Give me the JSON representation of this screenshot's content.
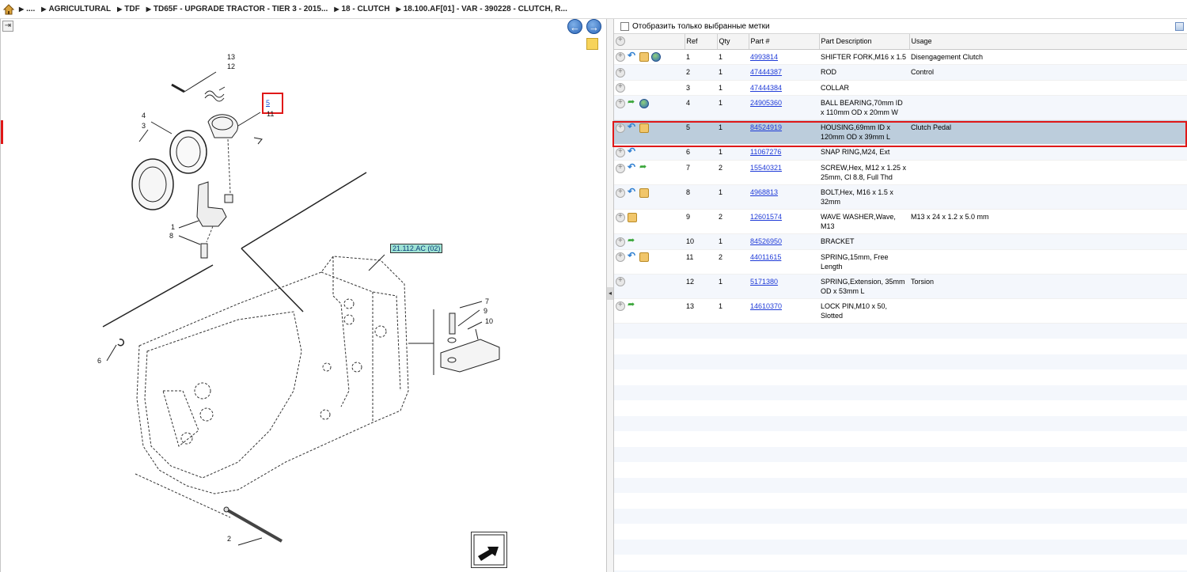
{
  "breadcrumb": {
    "items": [
      "....",
      "AGRICULTURAL",
      "TDF",
      "TD65F - UPGRADE TRACTOR - TIER 3 - 2015...",
      "18 - CLUTCH",
      "18.100.AF[01] - VAR - 390228 - CLUTCH, R..."
    ]
  },
  "diagram": {
    "ref_labels": [
      "13",
      "12",
      "5",
      "11",
      "4",
      "3",
      "1",
      "8",
      "7",
      "9",
      "10",
      "6",
      "2"
    ],
    "link_label": "21.112.AC (02)",
    "highlight_ref": "5"
  },
  "filter": {
    "label": "Отобразить только выбранные метки",
    "checked": false
  },
  "table": {
    "headers": [
      "Ref",
      "Qty",
      "Part #",
      "Part Description",
      "Usage"
    ],
    "rows": [
      {
        "icons": [
          "add-icon",
          "back-arrow-icon",
          "package-icon",
          "globe-icon"
        ],
        "ref": "1",
        "qty": "1",
        "part": "4993814",
        "desc": "SHIFTER FORK,M16 x 1.5",
        "usage": "Disengagement Clutch"
      },
      {
        "icons": [
          "add-icon"
        ],
        "ref": "2",
        "qty": "1",
        "part": "47444387",
        "desc": "ROD",
        "usage": "Control"
      },
      {
        "icons": [
          "add-icon"
        ],
        "ref": "3",
        "qty": "1",
        "part": "47444384",
        "desc": "COLLAR",
        "usage": ""
      },
      {
        "icons": [
          "add-icon",
          "forward-arrow-icon",
          "globe-icon"
        ],
        "ref": "4",
        "qty": "1",
        "part": "24905360",
        "desc": "BALL BEARING,70mm ID x 110mm OD x 20mm W",
        "usage": ""
      },
      {
        "icons": [
          "add-icon",
          "back-arrow-icon",
          "package-icon"
        ],
        "ref": "5",
        "qty": "1",
        "part": "84524919",
        "desc": "HOUSING,69mm ID x 120mm OD x 39mm L",
        "usage": "Clutch Pedal",
        "selected": true
      },
      {
        "icons": [
          "add-icon",
          "back-arrow-icon"
        ],
        "ref": "6",
        "qty": "1",
        "part": "11067276",
        "desc": "SNAP RING,M24, Ext",
        "usage": ""
      },
      {
        "icons": [
          "add-icon",
          "back-arrow-icon",
          "forward-arrow-icon"
        ],
        "ref": "7",
        "qty": "2",
        "part": "15540321",
        "desc": "SCREW,Hex, M12 x 1.25 x 25mm, Cl 8.8, Full Thd",
        "usage": ""
      },
      {
        "icons": [
          "add-icon",
          "back-arrow-icon",
          "package-icon"
        ],
        "ref": "8",
        "qty": "1",
        "part": "4968813",
        "desc": "BOLT,Hex, M16 x 1.5 x 32mm",
        "usage": ""
      },
      {
        "icons": [
          "add-icon",
          "package-icon"
        ],
        "ref": "9",
        "qty": "2",
        "part": "12601574",
        "desc": "WAVE WASHER,Wave, M13",
        "usage": "M13 x 24 x 1.2 x 5.0 mm"
      },
      {
        "icons": [
          "add-icon",
          "forward-arrow-icon"
        ],
        "ref": "10",
        "qty": "1",
        "part": "84526950",
        "desc": "BRACKET",
        "usage": ""
      },
      {
        "icons": [
          "add-icon",
          "back-arrow-icon",
          "package-icon"
        ],
        "ref": "11",
        "qty": "2",
        "part": "44011615",
        "desc": "SPRING,15mm, Free Length",
        "usage": ""
      },
      {
        "icons": [
          "add-icon"
        ],
        "ref": "12",
        "qty": "1",
        "part": "5171380",
        "desc": "SPRING,Extension, 35mm OD x 53mm L",
        "usage": "Torsion"
      },
      {
        "icons": [
          "add-icon",
          "forward-arrow-icon"
        ],
        "ref": "13",
        "qty": "1",
        "part": "14610370",
        "desc": "LOCK PIN,M10 x 50, Slotted",
        "usage": ""
      }
    ]
  },
  "colors": {
    "selected_row": "#bccddc",
    "highlight_border": "#e01818",
    "link": "#1f3bd8"
  }
}
